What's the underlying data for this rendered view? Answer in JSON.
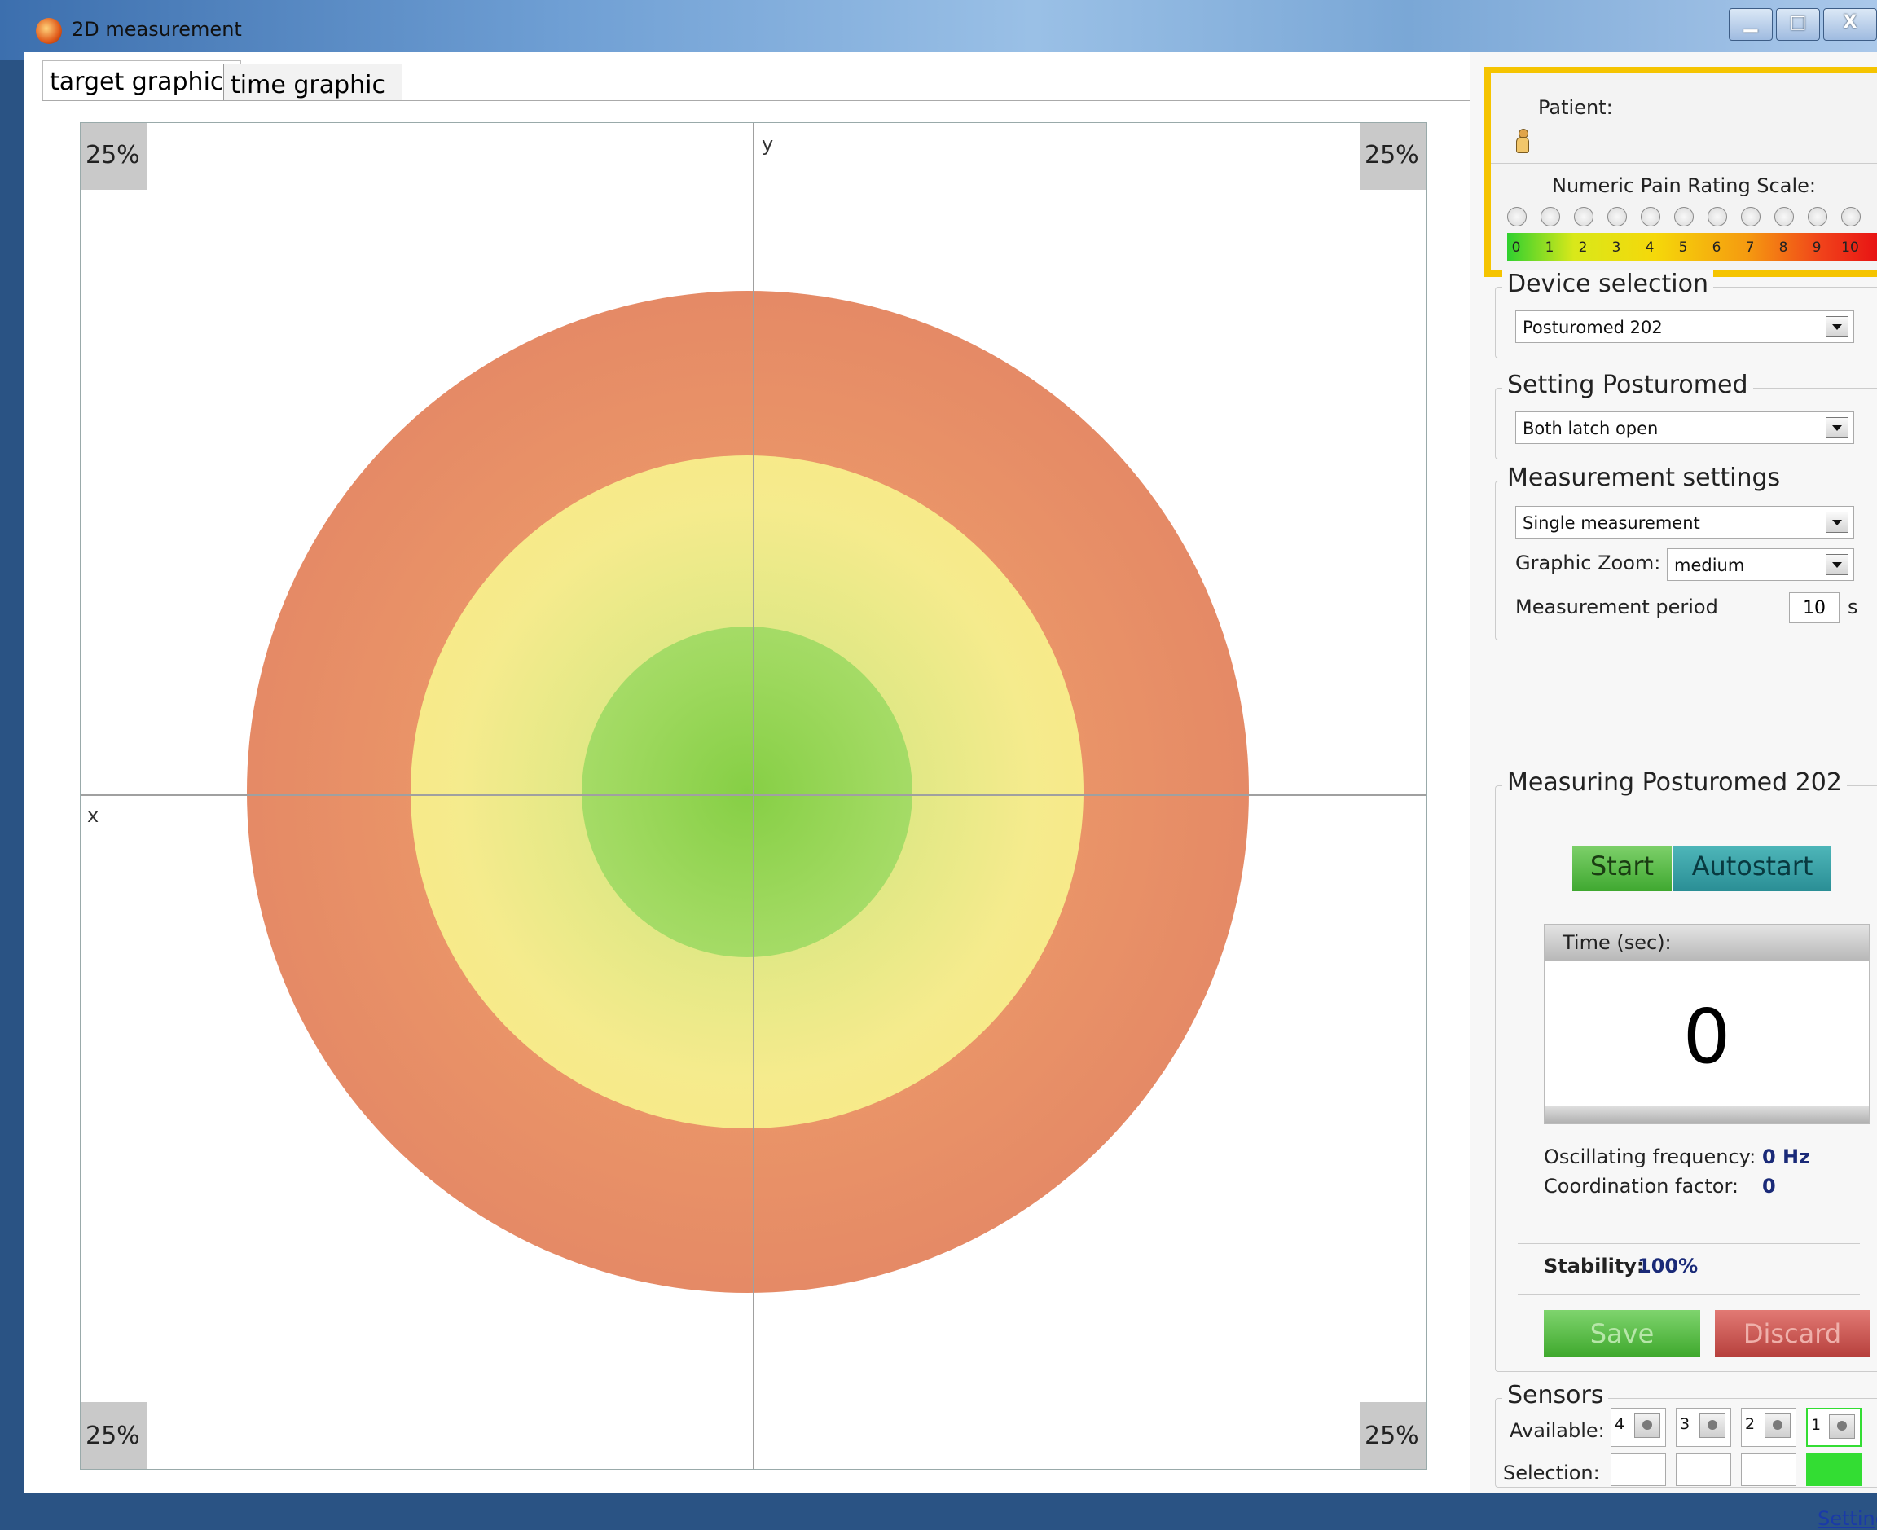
{
  "window": {
    "title": "2D measurement",
    "min_symbol": "▁",
    "max_symbol": "□",
    "close_symbol": "X"
  },
  "tabs": [
    {
      "label": "target graphic",
      "active": true
    },
    {
      "label": "time graphic",
      "active": false
    }
  ],
  "plot": {
    "x_label": "x",
    "y_label": "y",
    "corners": {
      "top_left": "25%",
      "top_right": "25%",
      "bottom_left": "25%",
      "bottom_right": "25%"
    }
  },
  "patient": {
    "label": "Patient:",
    "icon": "person-icon"
  },
  "pain_scale": {
    "title": "Numeric Pain Rating Scale:",
    "values": [
      "0",
      "1",
      "2",
      "3",
      "4",
      "5",
      "6",
      "7",
      "8",
      "9",
      "10"
    ],
    "selected": null
  },
  "device_selection": {
    "title": "Device selection",
    "value": "Posturomed 202"
  },
  "setting": {
    "title": "Setting Posturomed",
    "value": "Both latch open"
  },
  "measurement_settings": {
    "title": "Measurement settings",
    "mode": "Single measurement",
    "zoom_label": "Graphic Zoom:",
    "zoom_value": "medium",
    "period_label": "Measurement period",
    "period_value": "10",
    "period_unit": "s"
  },
  "measuring": {
    "title": "Measuring Posturomed 202",
    "start_label": "Start",
    "autostart_label": "Autostart",
    "time_header": "Time (sec):",
    "time_value": "0",
    "osc_label": "Oscillating frequency:",
    "osc_value": "0 Hz",
    "coord_label": "Coordination factor:",
    "coord_value": "0",
    "stability_label": "Stability:",
    "stability_value": "100%",
    "save_label": "Save",
    "discard_label": "Discard"
  },
  "sensors": {
    "title": "Sensors",
    "available_label": "Available:",
    "selection_label": "Selection:",
    "numbers": [
      "4",
      "3",
      "2",
      "1"
    ],
    "selected": "1",
    "settings_link": "Settings"
  },
  "colors": {
    "outer_ring": "#d67763",
    "middle_ring": "#fce67f",
    "inner_ring": "#86cf45",
    "highlight": "#f5c400",
    "selected_sensor": "#33dd33"
  }
}
